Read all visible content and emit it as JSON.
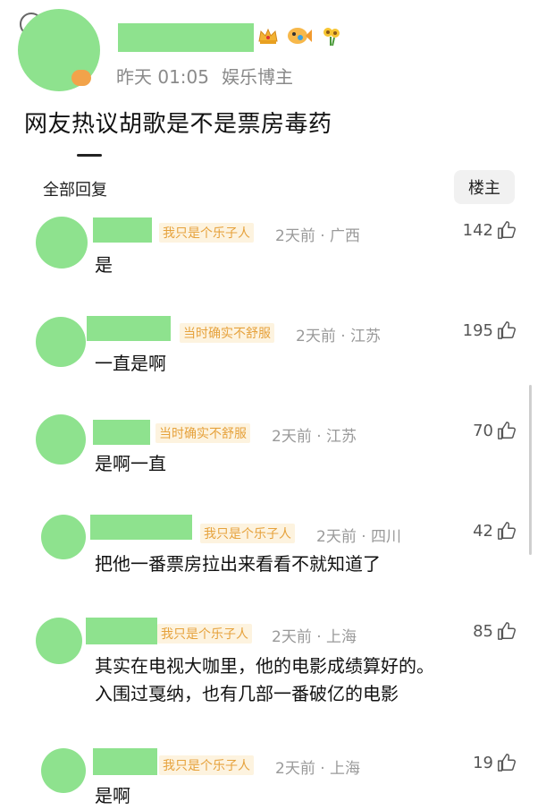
{
  "post": {
    "time": "昨天 01:05",
    "role": "娱乐博主",
    "title": "网友热议胡歌是不是票房毒药"
  },
  "replies_header": {
    "label": "全部回复",
    "owner_button": "楼主"
  },
  "comments": [
    {
      "badge": "我只是个乐子人",
      "meta": "2天前 · 广西",
      "likes": "142",
      "text": [
        "是"
      ]
    },
    {
      "badge": "当时确实不舒服",
      "meta": "2天前 · 江苏",
      "likes": "195",
      "text": [
        "一直是啊"
      ]
    },
    {
      "badge": "当时确实不舒服",
      "meta": "2天前 · 江苏",
      "likes": "70",
      "text": [
        "是啊一直"
      ]
    },
    {
      "badge": "我只是个乐子人",
      "meta": "2天前 · 四川",
      "likes": "42",
      "text": [
        "把他一番票房拉出来看看不就知道了"
      ]
    },
    {
      "badge": "我只是个乐子人",
      "meta": "2天前 · 上海",
      "likes": "85",
      "text": [
        "其实在电视大咖里，他的电影成绩算好的。",
        "入围过戛纳，也有几部一番破亿的电影"
      ]
    },
    {
      "badge": "我只是个乐子人",
      "meta": "2天前 · 上海",
      "likes": "19",
      "text": [
        "是啊"
      ]
    }
  ],
  "icons": {
    "like": "thumbs-up-icon",
    "crown": "crown-icon",
    "fish": "fish-icon",
    "flower": "sunflower-icon"
  },
  "colors": {
    "badge_text": "#e6a23c",
    "badge_bg": "#fdf3df",
    "meta_gray": "#9a9a9a",
    "redaction_green": "#8ee28e"
  }
}
